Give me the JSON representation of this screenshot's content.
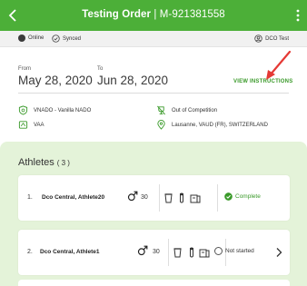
{
  "header": {
    "title": "Testing Order",
    "separator": "|",
    "order_id": "M-921381558"
  },
  "status": {
    "online": "Online",
    "synced": "Synced",
    "user": "DCO Test"
  },
  "mission": {
    "from_label": "From",
    "from_date": "May 28, 2020",
    "to_label": "To",
    "to_date": "Jun 28, 2020",
    "view_instructions": "VIEW INSTRUCTIONS",
    "organization": "VNADO - Vanilla NADO",
    "authority": "VAA",
    "competition": "Out of Competition",
    "location": "Lausanne, VAUD (FR), SWITZERLAND"
  },
  "athletes": {
    "title": "Athletes",
    "count": "( 3 )",
    "items": [
      {
        "index": "1.",
        "name": "Dco Central, Athlete20",
        "age": "30",
        "status": "Complete"
      },
      {
        "index": "2.",
        "name": "Dco Central, Athlete1",
        "age": "30",
        "status": "Not started"
      }
    ]
  },
  "colors": {
    "header_green": "#4caf38",
    "accent_green": "#3a9a2a",
    "panel_green": "#e4f3d9",
    "arrow_red": "#e53935"
  },
  "icons": {
    "back": "chevron-left-icon",
    "more": "more-vert-icon",
    "arrow": "annotation-arrow"
  }
}
